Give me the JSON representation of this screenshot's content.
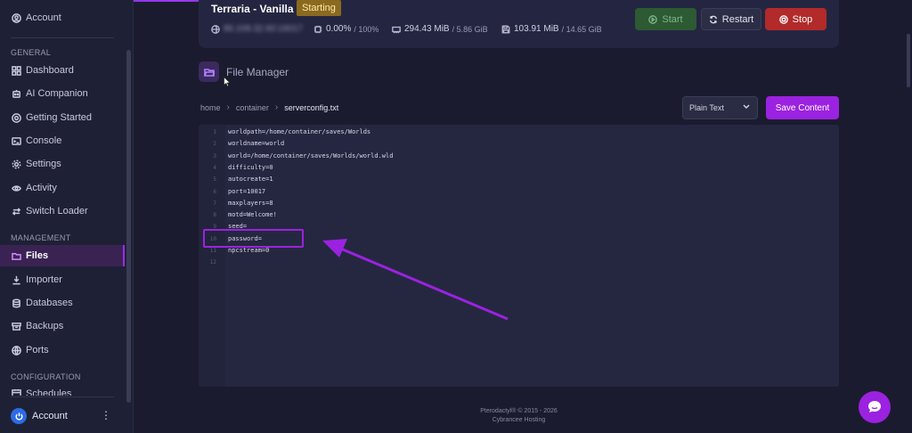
{
  "sidebar": {
    "account_top": "Account",
    "sections": {
      "general": "GENERAL",
      "management": "MANAGEMENT",
      "configuration": "CONFIGURATION"
    },
    "general_items": [
      {
        "label": "Dashboard",
        "icon": "grid-icon"
      },
      {
        "label": "AI Companion",
        "icon": "robot-icon"
      },
      {
        "label": "Getting Started",
        "icon": "lifebuoy-icon"
      },
      {
        "label": "Console",
        "icon": "terminal-icon"
      },
      {
        "label": "Settings",
        "icon": "gear-icon"
      },
      {
        "label": "Activity",
        "icon": "eye-icon"
      },
      {
        "label": "Switch Loader",
        "icon": "switch-icon"
      }
    ],
    "management_items": [
      {
        "label": "Files",
        "icon": "folder-icon",
        "active": true
      },
      {
        "label": "Importer",
        "icon": "download-icon"
      },
      {
        "label": "Databases",
        "icon": "database-icon"
      },
      {
        "label": "Backups",
        "icon": "archive-icon"
      },
      {
        "label": "Ports",
        "icon": "globe-icon"
      }
    ],
    "configuration_items": [
      {
        "label": "Schedules",
        "icon": "calendar-icon"
      }
    ],
    "account_bottom": "Account",
    "more": "⋮"
  },
  "server": {
    "name": "Terraria - Vanilla",
    "status": "Starting",
    "ip": "86.109.32.60:16017",
    "cpu": "0.00%",
    "cpu_limit": "/ 100%",
    "memory": "294.43 MiB",
    "memory_limit": "/ 5.86 GiB",
    "disk": "103.91 MiB",
    "disk_limit": "/ 14.65 GiB",
    "buttons": {
      "start": "Start",
      "restart": "Restart",
      "stop": "Stop"
    }
  },
  "file_manager": {
    "title": "File Manager",
    "breadcrumb": [
      "home",
      "container",
      "serverconfig.txt"
    ],
    "mode": "Plain Text",
    "save_label": "Save Content",
    "lines": [
      "worldpath=/home/container/saves/Worlds",
      "worldname=world",
      "world=/home/container/saves/Worlds/world.wld",
      "difficulty=0",
      "autocreate=1",
      "port=10017",
      "maxplayers=8",
      "motd=Welcome!",
      "seed=",
      "password=",
      "npcstream=0",
      ""
    ]
  },
  "footer": {
    "line1": "Pterodactyl® © 2015 - 2026",
    "line2": "Cybrancee Hosting"
  },
  "colors": {
    "accent": "#9b22e0",
    "status_starting": "#8a6a1f",
    "start": "#2d5a32",
    "stop": "#b22a2a"
  }
}
